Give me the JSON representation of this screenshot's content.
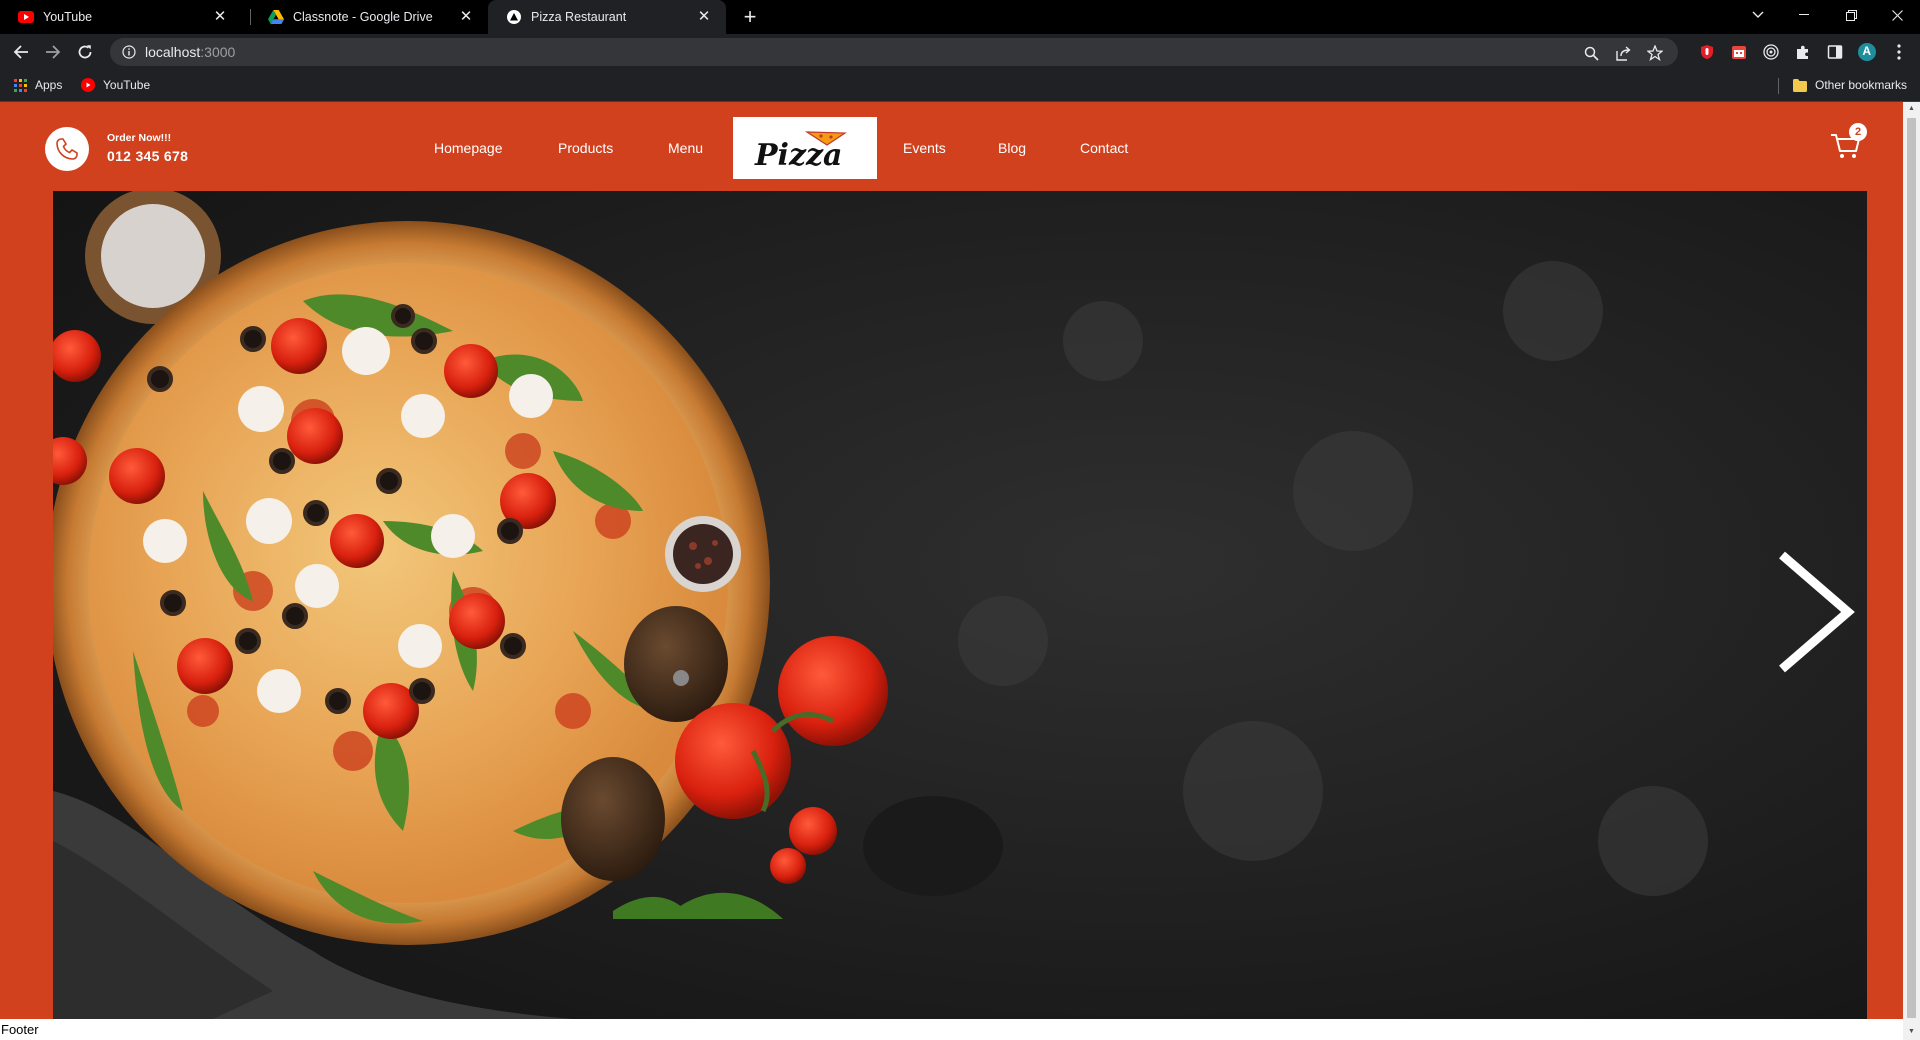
{
  "browser": {
    "tabs": [
      {
        "title": "YouTube",
        "icon": "youtube-icon",
        "active": false
      },
      {
        "title": "Classnote - Google Drive",
        "icon": "google-drive-icon",
        "active": false
      },
      {
        "title": "Pizza Restaurant",
        "icon": "vercel-triangle-icon",
        "active": true
      }
    ],
    "url_host": "localhost",
    "url_rest": ":3000",
    "bookmarks": {
      "apps": "Apps",
      "youtube": "YouTube",
      "other": "Other bookmarks"
    },
    "profile_initial": "A"
  },
  "site": {
    "colors": {
      "primary": "#d1411e",
      "hero_bg": "#1e1e1e"
    },
    "order_label": "Order Now!!!",
    "order_phone": "012 345 678",
    "nav_links": [
      "Homepage",
      "Products",
      "Menu",
      "Events",
      "Blog",
      "Contact"
    ],
    "logo_text": "Pizza",
    "cart_count": "2",
    "footer": "Footer"
  }
}
